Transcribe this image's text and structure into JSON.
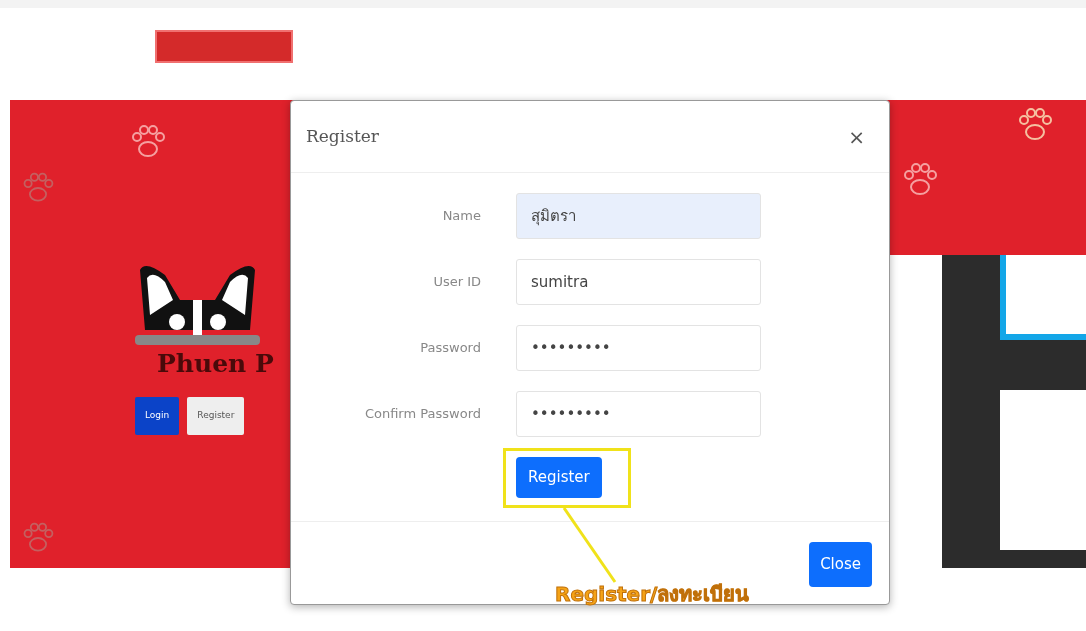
{
  "page": {
    "hero_title": "Phuen P",
    "buttons": [
      {
        "label": "Login",
        "kind": "primary"
      },
      {
        "label": "Register",
        "kind": "light"
      }
    ]
  },
  "modal": {
    "title": "Register",
    "close": "×",
    "fields": [
      {
        "label": "Name",
        "value": "สุมิตรา",
        "autofilled": true
      },
      {
        "label": "User ID",
        "value": "sumitra",
        "autofilled": false
      },
      {
        "label": "Password",
        "value": "•••••••••",
        "autofilled": false
      },
      {
        "label": "Confirm Password",
        "value": "•••••••••",
        "autofilled": false
      }
    ],
    "submit": "Register",
    "footer_button": "Close"
  },
  "annotation": {
    "text": "Register/ลงทะเบียน"
  }
}
